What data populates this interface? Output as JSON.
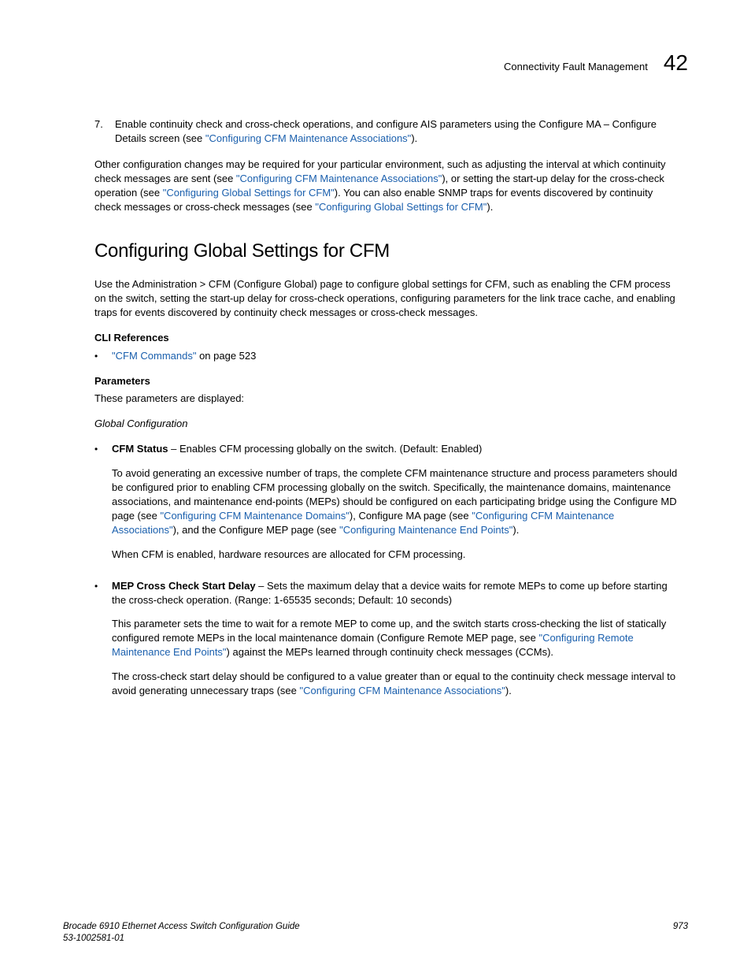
{
  "header": {
    "title": "Connectivity Fault Management",
    "chapter": "42"
  },
  "step7": {
    "num": "7.",
    "text_a": "Enable continuity check and cross-check operations, and configure AIS parameters using the Configure MA – Configure Details screen (see ",
    "link": "\"Configuring CFM Maintenance Associations\"",
    "text_b": ")."
  },
  "para1": {
    "a": "Other configuration changes may be required for your particular environment, such as adjusting the interval at which continuity check messages are sent (see ",
    "l1": "\"Configuring CFM Maintenance Associations\"",
    "b": "), or setting the start-up delay for the cross-check operation (see ",
    "l2": "\"Configuring Global Settings for CFM\"",
    "c": "). You can also enable SNMP traps for events discovered by continuity check messages or cross-check messages (see ",
    "l3": "\"Configuring Global Settings for CFM\"",
    "d": ")."
  },
  "section_title": "Configuring Global Settings for CFM",
  "para2": "Use the Administration > CFM (Configure Global) page to configure global settings for CFM, such as enabling the CFM process on the switch, setting the start-up delay for cross-check operations, configuring parameters for the link trace cache, and enabling traps for events discovered by continuity check messages or cross-check messages.",
  "cli_ref_h": "CLI References",
  "cli_ref": {
    "link": "\"CFM Commands\"",
    "tail": " on page 523"
  },
  "params_h": "Parameters",
  "params_intro": "These parameters are displayed:",
  "params_sub": "Global Configuration",
  "cfm_status": {
    "label": "CFM Status",
    "text": " – Enables CFM processing globally on the switch. (Default: Enabled)",
    "p1a": "To avoid generating an excessive number of traps, the complete CFM maintenance structure and process parameters should be configured prior to enabling CFM processing globally on the switch. Specifically, the maintenance domains, maintenance associations, and maintenance end-points (MEPs) should be configured on each participating bridge using the Configure MD page (see ",
    "l1": "\"Configuring CFM Maintenance Domains\"",
    "p1b": "), Configure MA page (see ",
    "l2": "\"Configuring CFM Maintenance Associations\"",
    "p1c": "), and the Configure MEP page (see ",
    "l3": "\"Configuring Maintenance End Points\"",
    "p1d": ").",
    "p2": "When CFM is enabled, hardware resources are allocated for CFM processing."
  },
  "mep_delay": {
    "label": "MEP Cross Check Start Delay",
    "text": " – Sets the maximum delay that a device waits for remote MEPs to come up before starting the cross-check operation. (Range: 1-65535 seconds; Default: 10 seconds)",
    "p1a": "This parameter sets the time to wait for a remote MEP to come up, and the switch starts cross-checking the list of statically configured remote MEPs in the local maintenance domain (Configure Remote MEP page, see ",
    "l1": "\"Configuring Remote Maintenance End Points\"",
    "p1b": ") against the MEPs learned through continuity check messages (CCMs).",
    "p2a": "The cross-check start delay should be configured to a value greater than or equal to the continuity check message interval to avoid generating unnecessary traps (see ",
    "l2": "\"Configuring CFM Maintenance Associations\"",
    "p2b": ")."
  },
  "footer": {
    "line1": "Brocade 6910 Ethernet Access Switch Configuration Guide",
    "line2": "53-1002581-01",
    "page": "973"
  }
}
